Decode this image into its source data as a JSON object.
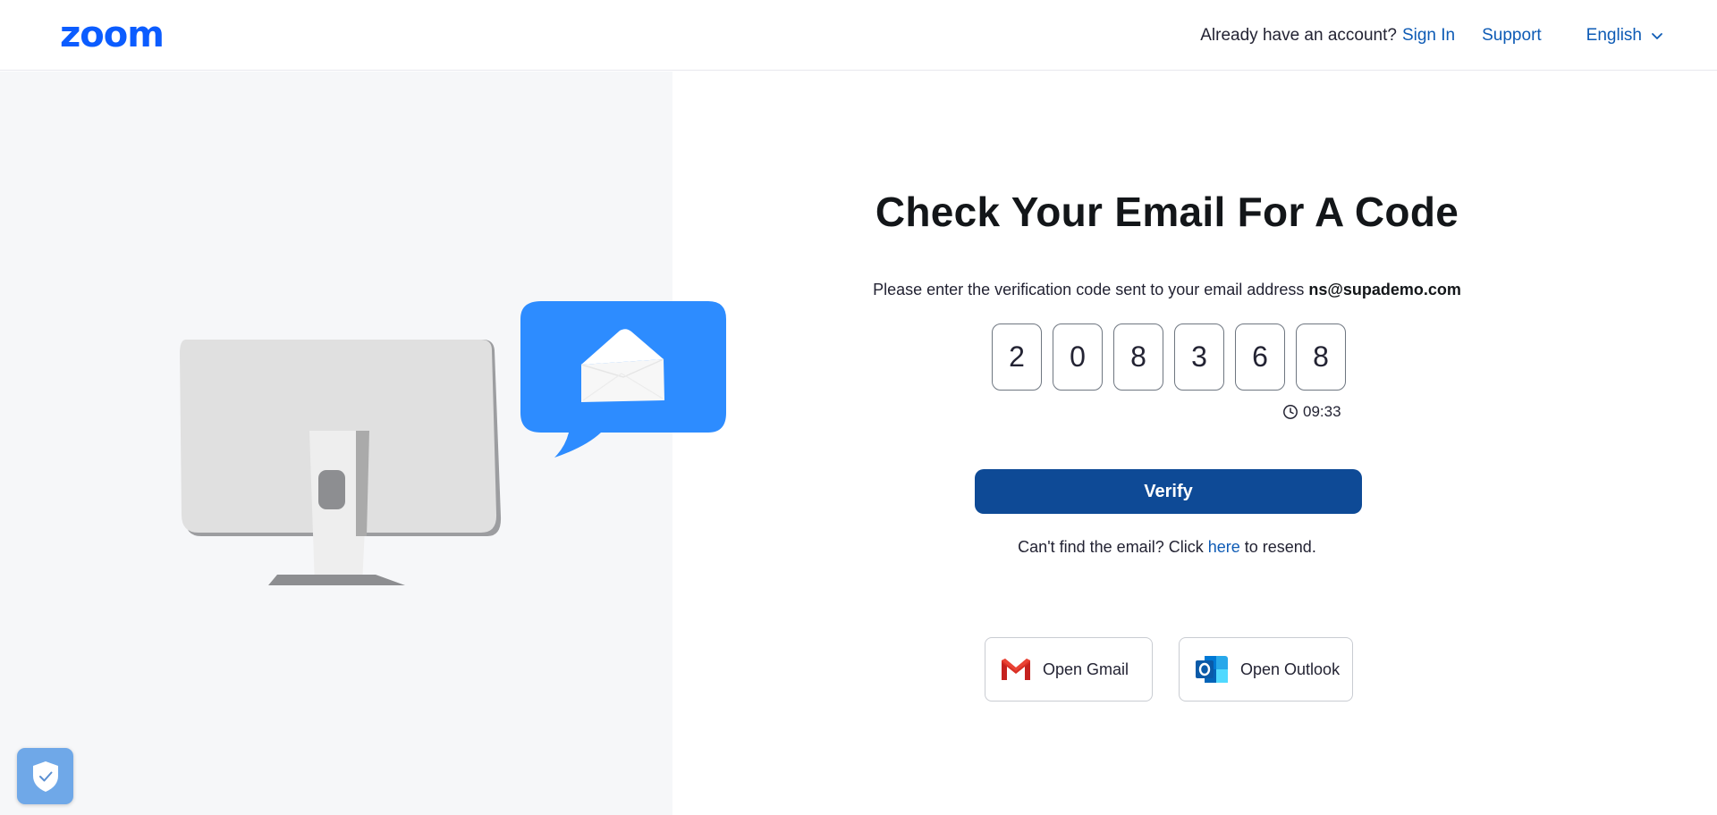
{
  "header": {
    "logo": "zoom",
    "already_text": "Already have an account?",
    "sign_in": "Sign In",
    "support": "Support",
    "language": "English"
  },
  "main": {
    "title": "Check Your Email For A Code",
    "instruction_prefix": "Please enter the verification code sent to your email address",
    "email": "ns@supademo.com",
    "code_digits": [
      "2",
      "0",
      "8",
      "3",
      "6",
      "8"
    ],
    "timer": "09:33",
    "verify_label": "Verify",
    "resend_prefix": "Can't find the email? Click",
    "resend_link": "here",
    "resend_suffix": "to resend.",
    "gmail_label": "Open Gmail",
    "outlook_label": "Open Outlook"
  },
  "colors": {
    "brand_blue": "#0b5cff",
    "link_blue": "#0e5bb5",
    "verify_bg": "#0e4a96",
    "left_panel_bg": "#f6f7f9",
    "bubble_blue": "#2d8cff"
  },
  "icons": {
    "language_chevron": "chevron-down-icon",
    "timer": "clock-icon",
    "gmail": "gmail-icon",
    "outlook": "outlook-icon",
    "badge": "shield-check-icon",
    "envelope": "envelope-icon"
  }
}
